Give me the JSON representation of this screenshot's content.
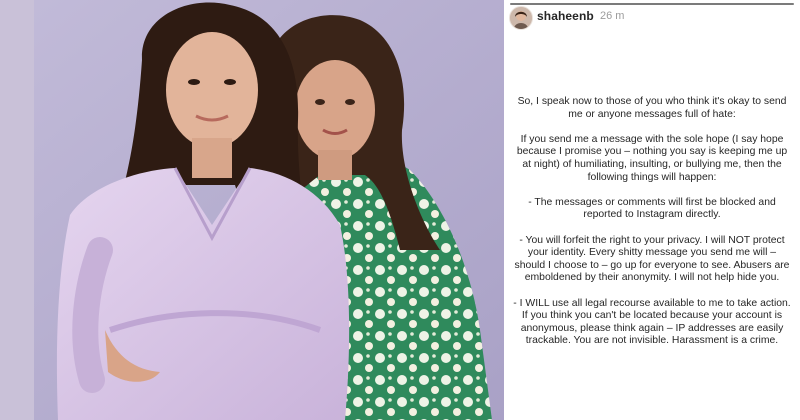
{
  "story": {
    "username": "shaheenb",
    "timestamp": "26 m",
    "progress": 1.0,
    "paragraphs": [
      "So,  I speak now to those of you who think it's okay to send me or anyone messages full of hate:",
      "If you send me a message with the sole hope (I say hope because I promise you – nothing you say is keeping me up at night) of humiliating, insulting, or bullying me, then the following things will happen:",
      "- The messages or comments will first be blocked and reported to Instagram directly.",
      "- You will forfeit the right to your privacy. I will NOT protect your identity. Every shitty message you send me will – should I choose to – go up for everyone to see. Abusers are emboldened by their anonymity. I will not help hide you.",
      "- I WILL use all legal recourse available to me to take action. If you think you can't be located because your account is anonymous, please think again – IP addresses are easily trackable. You are not invisible. Harassment is a crime."
    ]
  },
  "photo": {
    "background_color": "#b6aed0",
    "left_person_outfit_color": "#d9c7e6",
    "right_person_outfit_color": "#2f8a5c",
    "description_icon": "photo-two-women"
  }
}
